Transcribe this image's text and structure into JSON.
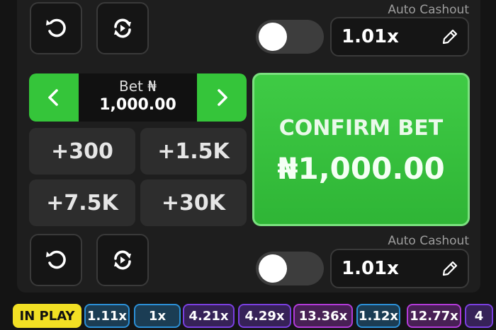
{
  "colors": {
    "accent_green": "#35c53a",
    "panel_bg": "#1e1e1e",
    "in_play_yellow": "#f2e024"
  },
  "top_bet": {
    "auto_cashout_label": "Auto Cashout",
    "auto_cashout_enabled": false,
    "cashout_value": "1.01x"
  },
  "bet": {
    "label": "Bet ₦",
    "amount": "1,000.00"
  },
  "quick_amounts": [
    "+300",
    "+1.5K",
    "+7.5K",
    "+30K"
  ],
  "confirm": {
    "title": "CONFIRM BET",
    "amount": "₦1,000.00"
  },
  "bottom_bet": {
    "auto_cashout_label": "Auto Cashout",
    "auto_cashout_enabled": false,
    "cashout_value": "1.01x"
  },
  "history": [
    {
      "label": "IN PLAY",
      "color": "#f2e024"
    },
    {
      "label": "1.11x",
      "color": "#2b8fd6"
    },
    {
      "label": "1x",
      "color": "#2b8fd6"
    },
    {
      "label": "4.21x",
      "color": "#7a3fe0"
    },
    {
      "label": "4.29x",
      "color": "#7a3fe0"
    },
    {
      "label": "13.36x",
      "color": "#b23ad8"
    },
    {
      "label": "1.12x",
      "color": "#2b8fd6"
    },
    {
      "label": "12.77x",
      "color": "#b23ad8"
    },
    {
      "label": "4",
      "color": "#7a3fe0"
    }
  ],
  "icons": {
    "undo": "undo-icon",
    "repeat": "repeat-icon",
    "prev": "chevron-left-icon",
    "next": "chevron-right-icon",
    "edit": "pencil-icon"
  }
}
